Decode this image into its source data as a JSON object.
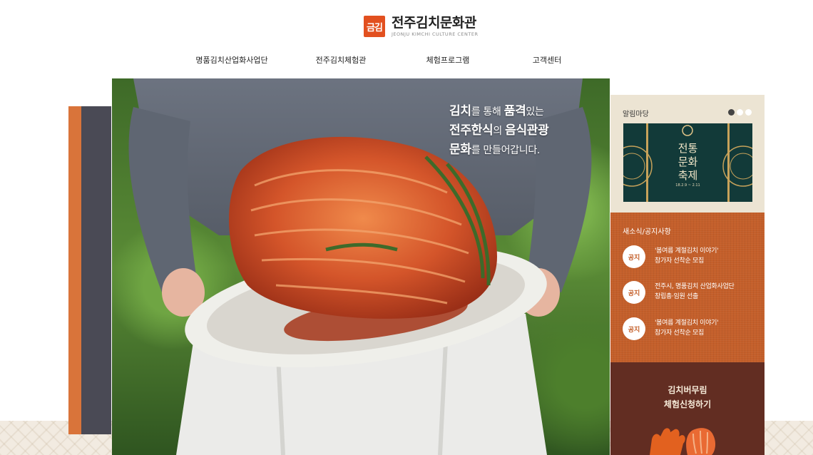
{
  "header": {
    "logo_mark": "금김",
    "logo_title": "전주김치문화관",
    "logo_subtitle": "JEONJU KIMCHI CULTURE CENTER"
  },
  "nav": {
    "items": [
      {
        "label": "명품김치산업화사업단"
      },
      {
        "label": "전주김치체험관"
      },
      {
        "label": "체험프로그램"
      },
      {
        "label": "고객센터"
      }
    ]
  },
  "hero": {
    "line1_bold": "김치",
    "line1_rest": "를 통해 ",
    "line1_bold2": "품격",
    "line1_rest2": "있는",
    "line2_bold": "전주한식",
    "line2_rest": "의 ",
    "line2_bold2": "음식관광",
    "line3_bold": "문화",
    "line3_rest": "를 만들어갑니다."
  },
  "notice_board": {
    "title": "알림마당",
    "banner_title_1": "전통",
    "banner_title_2": "문화",
    "banner_title_3": "축제",
    "banner_date": "18.2.9 ~ 2.11"
  },
  "news": {
    "title": "새소식/공지사항",
    "items": [
      {
        "badge": "공지",
        "line1": "'봄여름 계절김치 이야기'",
        "line2": "참가자 선착순 모집"
      },
      {
        "badge": "공지",
        "line1": "전주시, 명품김치 산업화사업단",
        "line2": "창립총·임원 선출"
      },
      {
        "badge": "공지",
        "line1": "'봄여름 계절김치 이야기'",
        "line2": "참가자 선착순 모집"
      }
    ]
  },
  "apply": {
    "line1": "김치버무림",
    "line2": "체험신청하기"
  },
  "colors": {
    "accent_orange": "#e2501f",
    "news_bg": "#c45f2a",
    "apply_bg": "#622d22",
    "board_bg": "#ece4d3"
  }
}
